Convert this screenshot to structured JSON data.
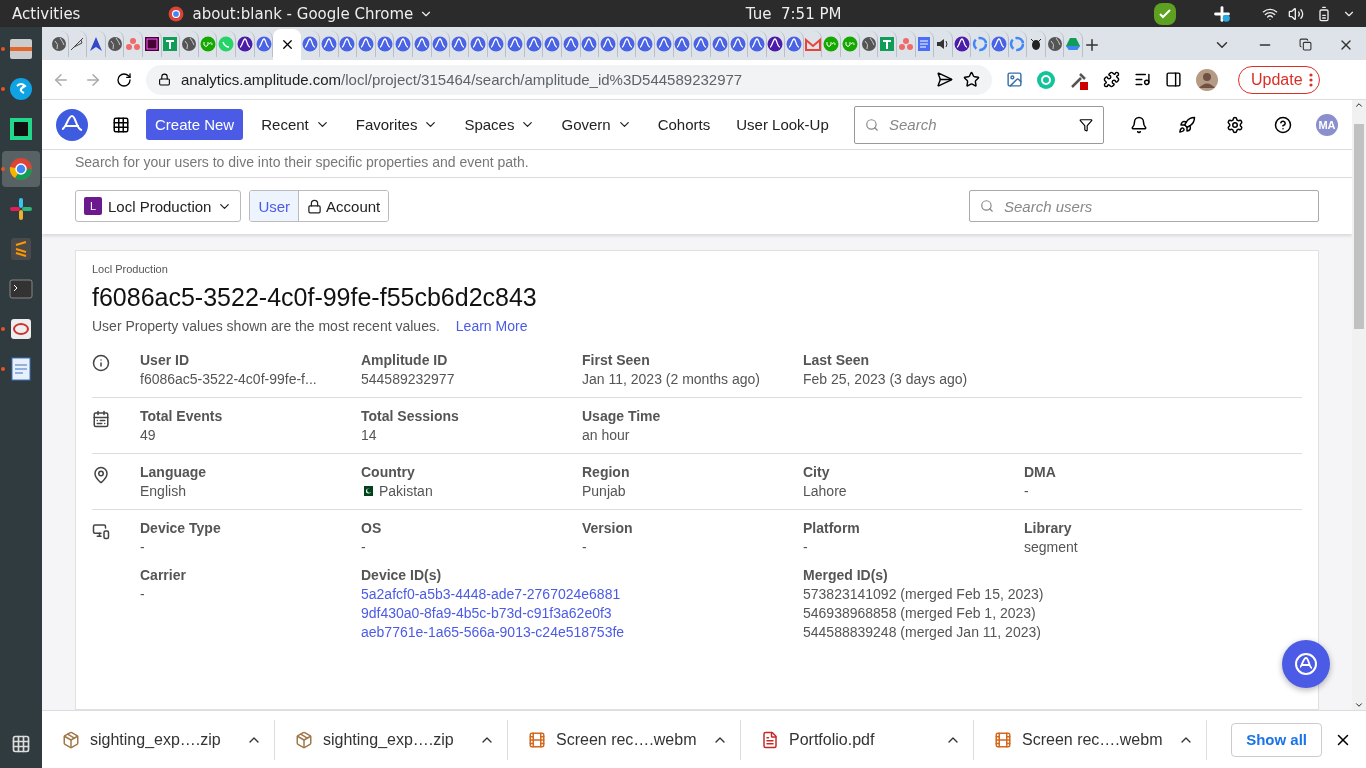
{
  "top_bar": {
    "activities": "Activities",
    "app_title": "about:blank - Google Chrome",
    "clock": "Tue  7:51 PM"
  },
  "dock": [
    {
      "kind": "files",
      "running": true,
      "selected": false
    },
    {
      "kind": "skype",
      "running": true,
      "selected": false
    },
    {
      "kind": "pycharm",
      "running": false,
      "selected": false
    },
    {
      "kind": "chrome",
      "running": true,
      "selected": true
    },
    {
      "kind": "slack",
      "running": false,
      "selected": false
    },
    {
      "kind": "sublime",
      "running": false,
      "selected": false
    },
    {
      "kind": "terminal",
      "running": false,
      "selected": false
    },
    {
      "kind": "recorder",
      "running": true,
      "selected": false
    },
    {
      "kind": "document",
      "running": true,
      "selected": false
    }
  ],
  "browser": {
    "tabs": [
      {
        "kind": "globe",
        "selected": false
      },
      {
        "kind": "feather",
        "selected": false
      },
      {
        "kind": "arrow",
        "selected": false
      },
      {
        "kind": "globe",
        "selected": false
      },
      {
        "kind": "dots",
        "selected": false
      },
      {
        "kind": "xd",
        "selected": false
      },
      {
        "kind": "cross",
        "selected": false
      },
      {
        "kind": "globe",
        "selected": false
      },
      {
        "kind": "upwork",
        "selected": false
      },
      {
        "kind": "whatsapp",
        "selected": false
      },
      {
        "kind": "amplitude-dark",
        "selected": false
      },
      {
        "kind": "amplitude",
        "selected": false
      },
      {
        "selected": true
      },
      {
        "kind": "amplitude",
        "selected": false
      },
      {
        "kind": "amplitude",
        "selected": false
      },
      {
        "kind": "amplitude",
        "selected": false
      },
      {
        "kind": "amplitude",
        "selected": false
      },
      {
        "kind": "amplitude",
        "selected": false
      },
      {
        "kind": "amplitude",
        "selected": false
      },
      {
        "kind": "amplitude",
        "selected": false
      },
      {
        "kind": "amplitude",
        "selected": false
      },
      {
        "kind": "amplitude",
        "selected": false
      },
      {
        "kind": "amplitude",
        "selected": false
      },
      {
        "kind": "amplitude",
        "selected": false
      },
      {
        "kind": "amplitude",
        "selected": false
      },
      {
        "kind": "amplitude",
        "selected": false
      },
      {
        "kind": "amplitude",
        "selected": false
      },
      {
        "kind": "amplitude",
        "selected": false
      },
      {
        "kind": "amplitude",
        "selected": false
      },
      {
        "kind": "amplitude",
        "selected": false
      },
      {
        "kind": "amplitude",
        "selected": false
      },
      {
        "kind": "amplitude",
        "selected": false
      },
      {
        "kind": "amplitude",
        "selected": false
      },
      {
        "kind": "amplitude",
        "selected": false
      },
      {
        "kind": "amplitude",
        "selected": false
      },
      {
        "kind": "amplitude",
        "selected": false
      },
      {
        "kind": "amplitude",
        "selected": false
      },
      {
        "kind": "amplitude",
        "selected": false
      },
      {
        "kind": "amplitude-dark",
        "selected": false
      },
      {
        "kind": "amplitude",
        "selected": false
      },
      {
        "kind": "gmail",
        "selected": false
      },
      {
        "kind": "upwork",
        "selected": false
      },
      {
        "kind": "upwork",
        "selected": false
      },
      {
        "kind": "globe",
        "selected": false
      },
      {
        "kind": "cross",
        "selected": false
      },
      {
        "kind": "dots",
        "selected": false
      },
      {
        "kind": "docs",
        "selected": false
      },
      {
        "kind": "sound",
        "selected": false
      },
      {
        "kind": "amplitude-dark",
        "selected": false
      },
      {
        "kind": "google",
        "selected": false
      },
      {
        "kind": "amplitude",
        "selected": false
      },
      {
        "kind": "google",
        "selected": false
      },
      {
        "kind": "bug",
        "selected": false
      },
      {
        "kind": "globe",
        "selected": false
      },
      {
        "kind": "drive",
        "selected": false
      }
    ],
    "address": {
      "host": "analytics.amplitude.com",
      "path": "/locl/project/315464/search/amplitude_id%3D544589232977"
    },
    "update_button": "Update"
  },
  "nav": {
    "create_button": "Create New",
    "menus": [
      {
        "label": "Recent",
        "dropdown": true
      },
      {
        "label": "Favorites",
        "dropdown": true
      },
      {
        "label": "Spaces",
        "dropdown": true
      },
      {
        "label": "Govern",
        "dropdown": true
      },
      {
        "label": "Cohorts",
        "dropdown": false
      },
      {
        "label": "User Look-Up",
        "dropdown": false
      }
    ],
    "search": {
      "placeholder": "Search"
    },
    "avatar": "MA"
  },
  "page": {
    "subtitle": "Search for your users to dive into their specific properties and event path.",
    "project": {
      "badge": "L",
      "name": "Locl Production"
    },
    "toggle": [
      {
        "label": "User",
        "selected": true,
        "locked": false
      },
      {
        "label": "Account",
        "selected": false,
        "locked": true
      }
    ],
    "search": {
      "placeholder": "Search users"
    }
  },
  "profile": {
    "project": "Locl Production",
    "user_id": "f6086ac5-3522-4c0f-99fe-f55cb6d2c843",
    "note": "User Property values shown are the most recent values.",
    "learn_more": "Learn More",
    "sections": [
      {
        "kind": "info",
        "rows": [
          [
            {
              "kind": "text",
              "label": "User ID",
              "value": "f6086ac5-3522-4c0f-99fe-f..."
            },
            {
              "kind": "text",
              "label": "Amplitude ID",
              "value": "544589232977"
            },
            {
              "kind": "text",
              "label": "First Seen",
              "value": "Jan 11, 2023 (2 months ago)"
            },
            {
              "kind": "text",
              "label": "Last Seen",
              "value": "Feb 25, 2023 (3 days ago)"
            }
          ]
        ]
      },
      {
        "kind": "events",
        "rows": [
          [
            {
              "kind": "text",
              "label": "Total Events",
              "value": "49"
            },
            {
              "kind": "text",
              "label": "Total Sessions",
              "value": "14"
            },
            {
              "kind": "text",
              "label": "Usage Time",
              "value": "an hour"
            }
          ]
        ]
      },
      {
        "kind": "location",
        "rows": [
          [
            {
              "kind": "text",
              "label": "Language",
              "value": "English"
            },
            {
              "kind": "flag",
              "label": "Country",
              "value": "Pakistan"
            },
            {
              "kind": "text",
              "label": "Region",
              "value": "Punjab"
            },
            {
              "kind": "text",
              "label": "City",
              "value": "Lahore"
            },
            {
              "kind": "text",
              "label": "DMA",
              "value": "-"
            }
          ]
        ]
      },
      {
        "kind": "device",
        "rows": [
          [
            {
              "kind": "text",
              "label": "Device Type",
              "value": "-"
            },
            {
              "kind": "text",
              "label": "OS",
              "value": "-"
            },
            {
              "kind": "text",
              "label": "Version",
              "value": "-"
            },
            {
              "kind": "text",
              "label": "Platform",
              "value": "-"
            },
            {
              "kind": "text",
              "label": "Library",
              "value": "segment"
            }
          ],
          [
            {
              "kind": "text",
              "label": "Carrier",
              "value": "-"
            },
            {
              "kind": "links",
              "label": "Device ID(s)",
              "values": [
                "5a2afcf0-a5b3-4448-ade7-2767024e6881",
                "9df430a0-8fa9-4b5c-b73d-c91f3a62e0f3",
                "aeb7761e-1a65-566a-9013-c24e518753fe"
              ]
            },
            "",
            {
              "kind": "list",
              "label": "Merged ID(s)",
              "values": [
                "573823141092 (merged Feb 15, 2023)",
                "546938968858 (merged Feb 1, 2023)",
                "544588839248 (merged Jan 11, 2023)"
              ]
            }
          ]
        ]
      }
    ]
  },
  "downloads": {
    "items": [
      {
        "kind": "archive",
        "name": "sighting_exp….zip"
      },
      {
        "kind": "archive",
        "name": "sighting_exp….zip"
      },
      {
        "kind": "video",
        "name": "Screen rec….webm"
      },
      {
        "kind": "pdf",
        "name": "Portfolio.pdf"
      },
      {
        "kind": "video",
        "name": "Screen rec….webm"
      }
    ],
    "show_all": "Show all"
  }
}
